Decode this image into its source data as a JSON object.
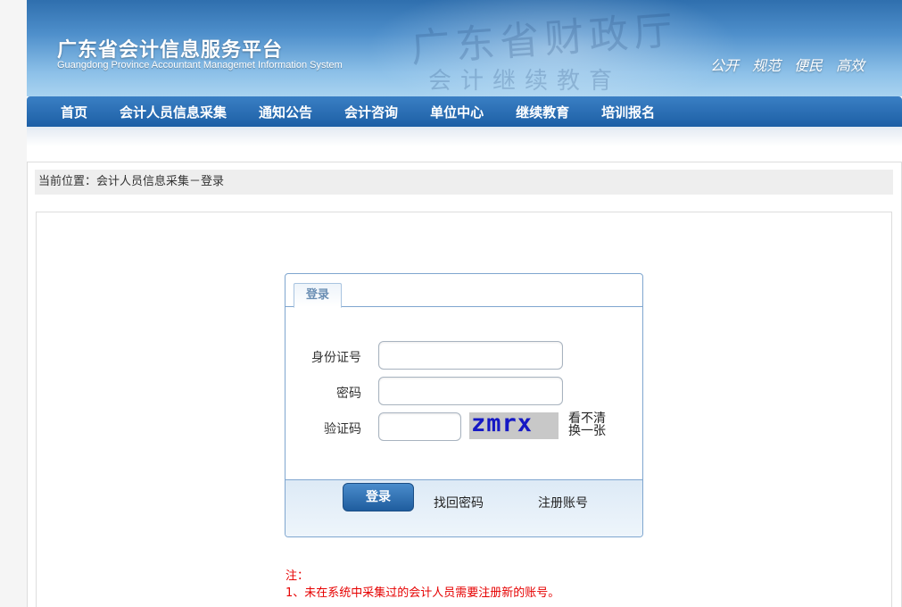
{
  "header": {
    "title_cn": "广东省会计信息服务平台",
    "title_en": "Guangdong Province Accountant Managemet Information System",
    "slogans": [
      "公开",
      "规范",
      "便民",
      "高效"
    ]
  },
  "nav": {
    "items": [
      "首页",
      "会计人员信息采集",
      "通知公告",
      "会计咨询",
      "单位中心",
      "继续教育",
      "培训报名"
    ]
  },
  "breadcrumb": "当前位置：会计人员信息采集－登录",
  "login": {
    "tab": "登录",
    "id_label": "身份证号",
    "id_value": "",
    "password_label": "密码",
    "password_value": "",
    "captcha_label": "验证码",
    "captcha_value": "",
    "captcha_text": "zmrx",
    "refresh_label": "看不清换一张",
    "submit": "登录",
    "forgot": "找回密码",
    "register": "注册账号"
  },
  "notes": {
    "heading": "注：",
    "lines": [
      "1、未在系统中采集过的会计人员需要注册新的账号。"
    ]
  }
}
